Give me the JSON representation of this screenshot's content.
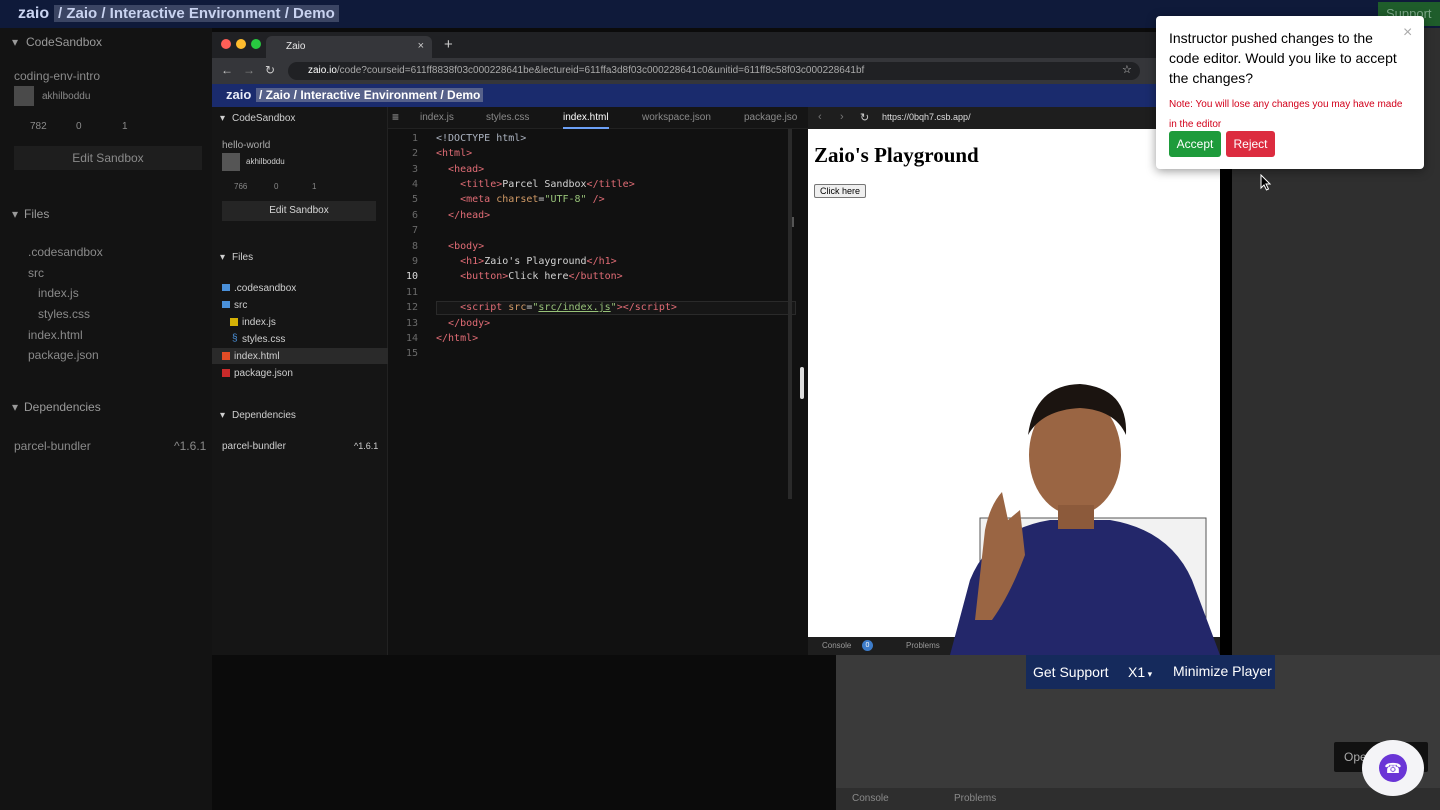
{
  "bg": {
    "logo": "zaio",
    "breadcrumb": "/ Zaio / Interactive Environment / Demo",
    "support": "Support",
    "sidebar_title": "CodeSandbox",
    "project": "coding-env-intro",
    "user": "akhilboddu",
    "stats": [
      "782",
      "0",
      "1"
    ],
    "edit_sandbox": "Edit Sandbox",
    "files_title": "Files",
    "files": [
      ".codesandbox",
      "src",
      "index.js",
      "styles.css",
      "index.html",
      "package.json"
    ],
    "deps_title": "Dependencies",
    "dep_name": "parcel-bundler",
    "dep_ver": "^1.6.1",
    "open_label": "Ope",
    "console_label": "Console",
    "problems_label": "Problems"
  },
  "browser": {
    "tab_title": "Zaio",
    "url_host": "zaio.io",
    "url_path": "/code?courseid=611ff8838f03c000228641be&lectureid=611ffa3d8f03c000228641c0&unitid=611ff8c58f03c000228641bf",
    "inner_logo": "zaio",
    "inner_breadcrumb": "/ Zaio / Interactive Environment / Demo"
  },
  "csb": {
    "title": "CodeSandbox",
    "project": "hello-world",
    "user": "akhilboddu",
    "stats": [
      "766",
      "0",
      "1"
    ],
    "edit_sandbox": "Edit Sandbox",
    "files_title": "Files",
    "files": [
      ".codesandbox",
      "src",
      "index.js",
      "styles.css",
      "index.html",
      "package.json"
    ],
    "deps_title": "Dependencies",
    "dep_name": "parcel-bundler",
    "dep_ver": "^1.6.1"
  },
  "editor": {
    "tabs": [
      "index.js",
      "styles.css",
      "index.html",
      "workspace.json",
      "package.jso"
    ],
    "active_tab": "index.html",
    "lines": [
      "1",
      "2",
      "3",
      "4",
      "5",
      "6",
      "7",
      "8",
      "9",
      "10",
      "11",
      "12",
      "13",
      "14",
      "15"
    ]
  },
  "preview": {
    "url": "https://0bqh7.csb.app/",
    "heading": "Zaio's Playground",
    "button": "Click here",
    "console": "Console",
    "console_count": "0",
    "problems": "Problems"
  },
  "player": {
    "get_support": "Get Support",
    "speed": "X1",
    "minimize": "Minimize Player"
  },
  "dialog": {
    "message": "Instructor pushed changes to the code editor. Would you like to accept the changes?",
    "note": "Note: You will lose any changes you may have made in the editor",
    "accept": "Accept",
    "reject": "Reject",
    "close": "×"
  },
  "colors": {
    "accept": "#1e9b3b",
    "reject": "#dc2c3f",
    "note": "#d2001a",
    "topbar": "#1a2b6d"
  }
}
